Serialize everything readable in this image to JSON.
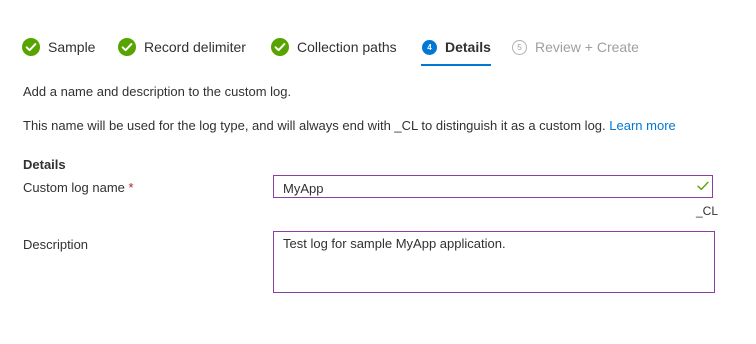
{
  "wizard": {
    "steps": [
      {
        "label": "Sample",
        "state": "completed",
        "icon": "check-circle-icon"
      },
      {
        "label": "Record delimiter",
        "state": "completed",
        "icon": "check-circle-icon"
      },
      {
        "label": "Collection paths",
        "state": "completed",
        "icon": "check-circle-icon"
      },
      {
        "label": "Details",
        "state": "current",
        "number": "4"
      },
      {
        "label": "Review + Create",
        "state": "disabled",
        "number": "5"
      }
    ]
  },
  "intro": "Add a name and description to the custom log.",
  "info": {
    "text": "This name will be used for the log type, and will always end with _CL to distinguish it as a custom log.",
    "link": "Learn more"
  },
  "details": {
    "heading": "Details",
    "name_label": "Custom log name",
    "required_marker": "*",
    "name_value": "MyApp",
    "name_suffix": "_CL",
    "description_label": "Description",
    "description_value": "Test log for sample MyApp application."
  },
  "colors": {
    "accent": "#0078d4",
    "success": "#57a300",
    "focus_border": "#8a3fa5",
    "disabled": "#a19f9d"
  }
}
